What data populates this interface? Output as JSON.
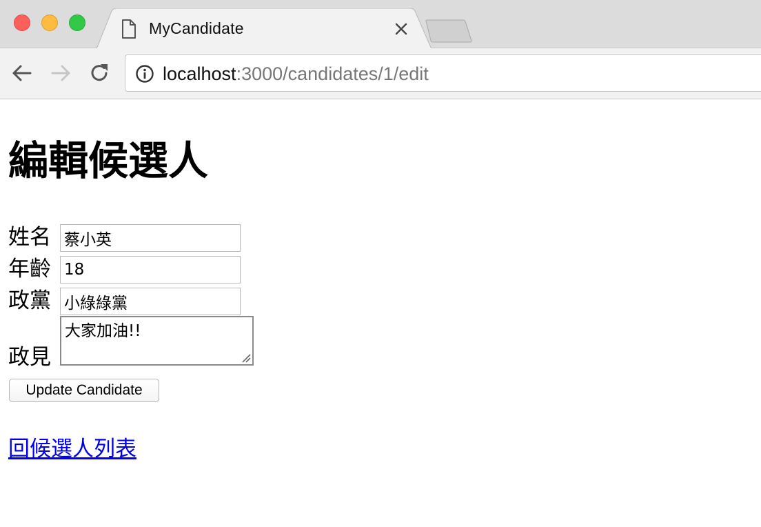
{
  "browser": {
    "tab": {
      "title": "MyCandidate"
    },
    "address": {
      "host": "localhost",
      "path": ":3000/candidates/1/edit"
    },
    "icons": {
      "window_close": "red-traffic-light",
      "window_minimize": "yellow-traffic-light",
      "window_maximize": "green-traffic-light",
      "tab_favicon": "document-icon",
      "tab_close": "close-icon",
      "back": "arrow-left-icon",
      "forward": "arrow-right-icon",
      "reload": "reload-icon",
      "site_info": "info-icon"
    }
  },
  "page": {
    "title": "編輯候選人",
    "form": {
      "name_label": "姓名",
      "name_value": "蔡小英",
      "age_label": "年齡",
      "age_value": "18",
      "party_label": "政黨",
      "party_value": "小綠綠黨",
      "policy_label": "政見",
      "policy_value": "大家加油!!",
      "submit_label": "Update Candidate"
    },
    "back_link": "回候選人列表"
  },
  "colors": {
    "link": "#0000ee",
    "tabstrip": "#dcdcdc",
    "toolbar": "#f2f2f2",
    "traffic_close": "#fc605c",
    "traffic_minimize": "#fdbc40",
    "traffic_maximize": "#34c84a"
  }
}
